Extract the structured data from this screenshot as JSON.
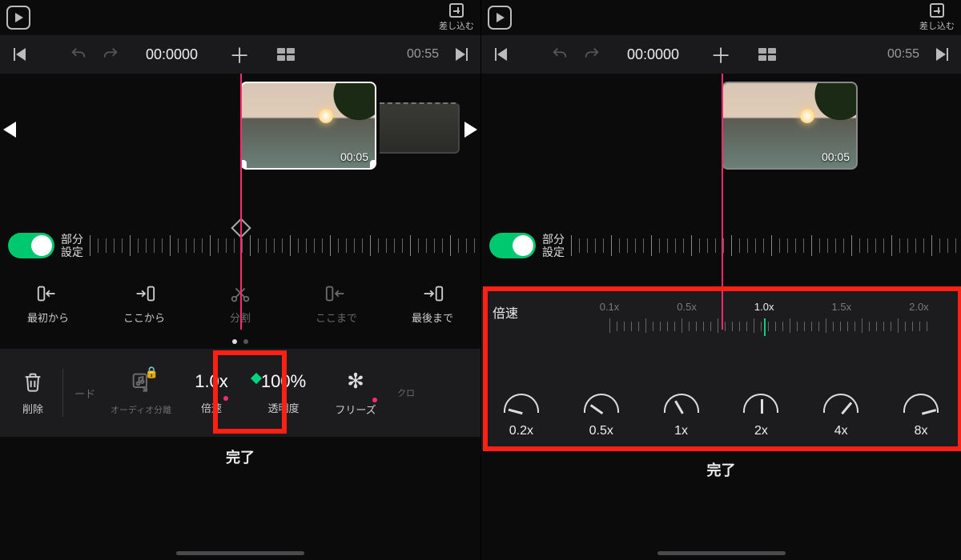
{
  "insert_label": "差し込む",
  "timecode": "00:00",
  "timecode_ms": "00",
  "duration": "00:55",
  "clip_ts": "00:05",
  "toggle_label_line1": "部分",
  "toggle_label_line2": "設定",
  "trim": {
    "from_start": "最初から",
    "from_here": "ここから",
    "split": "分割",
    "to_here": "ここまで",
    "to_end": "最後まで"
  },
  "tools_left": {
    "delete": "削除",
    "mode_frag": "ード",
    "audio_split": "オーディオ分離",
    "speed_value": "1.0x",
    "speed_label": "倍速",
    "opacity_value": "100%",
    "opacity_label": "透明度",
    "freeze": "フリーズ",
    "crop_frag": "クロ"
  },
  "speed_panel": {
    "title": "倍速",
    "scale": [
      "0.1x",
      "0.5x",
      "1.0x",
      "1.5x",
      "2.0x"
    ],
    "selected": "1.0x",
    "presets": [
      "0.2x",
      "0.5x",
      "1x",
      "2x",
      "4x",
      "8x"
    ],
    "needle_deg": [
      -75,
      -55,
      -30,
      0,
      40,
      75
    ]
  },
  "done": "完了"
}
